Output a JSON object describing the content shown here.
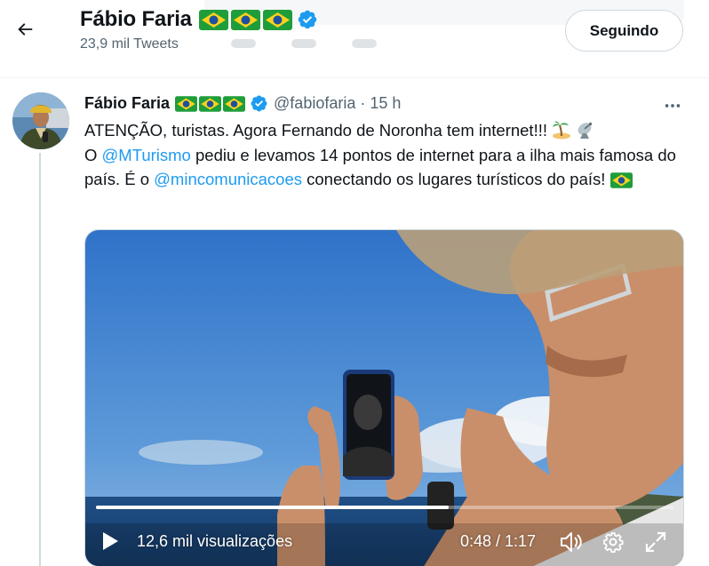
{
  "header": {
    "name": "Fábio Faria",
    "tweet_count": "23,9 mil Tweets",
    "follow_label": "Seguindo",
    "flags": [
      "brazil-flag",
      "brazil-flag",
      "brazil-flag"
    ]
  },
  "tweet": {
    "author_name": "Fábio Faria",
    "handle": "@fabiofaria",
    "separator": "·",
    "time": "15 h",
    "text_line1": "ATENÇÃO, turistas. Agora Fernando de Noronha tem internet!!!",
    "text_line2_pre": "O ",
    "mention1": "@MTurismo",
    "text_line2_mid": " pediu e levamos 14 pontos de internet para a ilha mais famosa do país. É o ",
    "mention2": "@mincomunicacoes",
    "text_line2_post": " conectando os lugares turísticos do país!",
    "emojis": [
      "island-emoji",
      "satellite-dish-emoji",
      "brazil-flag"
    ]
  },
  "video": {
    "views": "12,6 mil visualizações",
    "timecode": "0:48 / 1:17",
    "progress_fraction": 0.61,
    "icons": [
      "play-icon",
      "volume-icon",
      "gear-icon",
      "fullscreen-icon"
    ]
  },
  "colors": {
    "accent": "#1d9bf0",
    "text": "#0f1419",
    "muted": "#536471",
    "border": "#cfd9de"
  }
}
